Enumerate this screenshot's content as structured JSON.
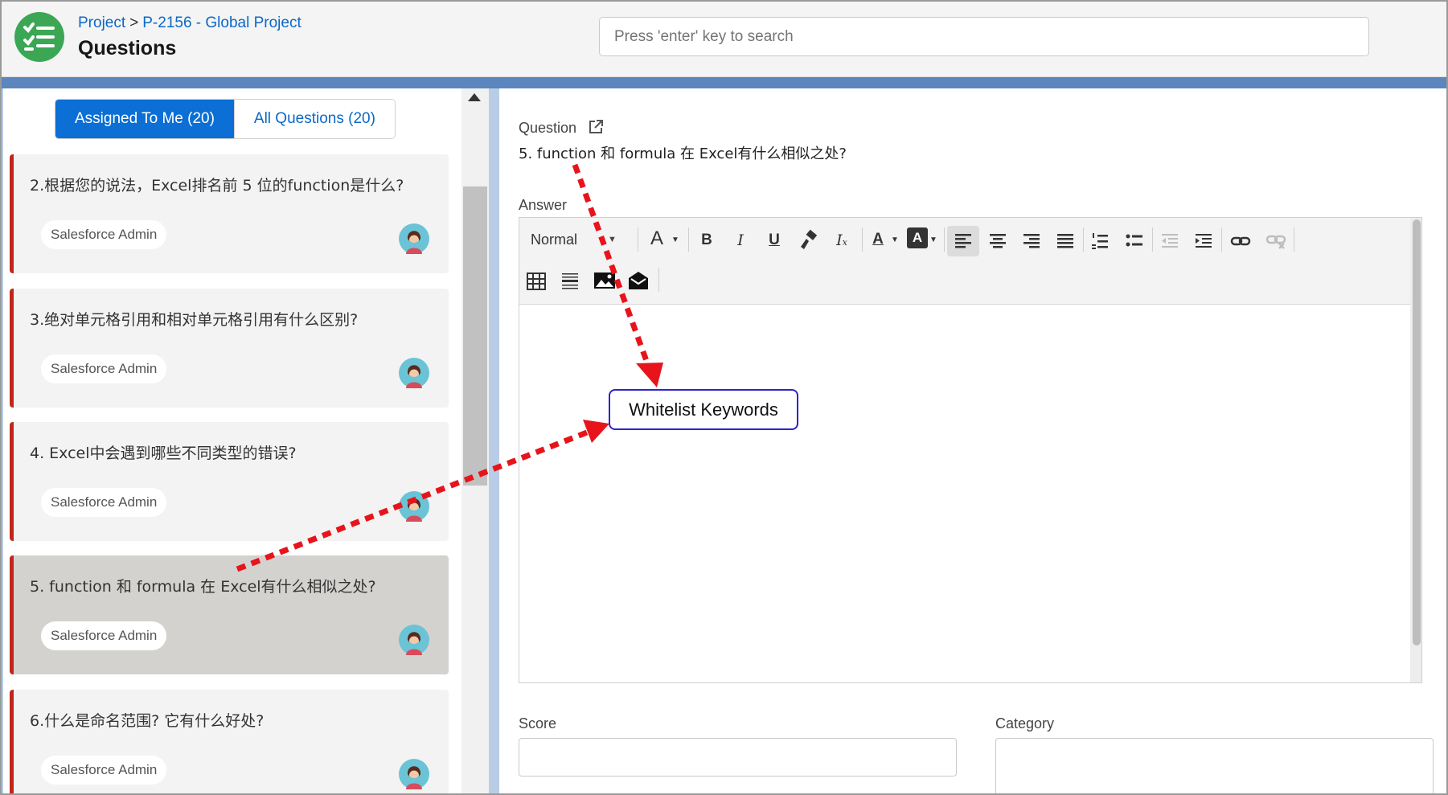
{
  "header": {
    "breadcrumb_root": "Project",
    "breadcrumb_separator": ">",
    "breadcrumb_current": "P-2156 - Global Project",
    "title": "Questions",
    "search_placeholder": "Press 'enter' key to search",
    "app_icon": "checklist-icon",
    "app_color": "#3ba755"
  },
  "tabs": {
    "assigned": "Assigned To Me (20)",
    "all": "All Questions (20)"
  },
  "questions": [
    {
      "title": "2.根据您的说法，Excel排名前 5 位的function是什么?",
      "owner": "Salesforce Admin"
    },
    {
      "title": "3.绝对单元格引用和相对单元格引用有什么区别?",
      "owner": "Salesforce Admin"
    },
    {
      "title": "4. Excel中会遇到哪些不同类型的错误?",
      "owner": "Salesforce Admin"
    },
    {
      "title": "5. function 和 formula 在 Excel有什么相似之处?",
      "owner": "Salesforce Admin"
    },
    {
      "title": "6.什么是命名范围? 它有什么好处?",
      "owner": "Salesforce Admin"
    }
  ],
  "detail": {
    "question_label": "Question",
    "question_text": "5. function 和 formula 在 Excel有什么相似之处?",
    "answer_label": "Answer",
    "format_select": "Normal",
    "score_label": "Score",
    "category_label": "Category"
  },
  "annotation": {
    "callout": "Whitelist Keywords",
    "arrow_color": "#e8141b"
  },
  "colors": {
    "accent": "#0b6fd5",
    "card_stripe": "#c0271a",
    "selected_card": "#d4d2cf"
  }
}
